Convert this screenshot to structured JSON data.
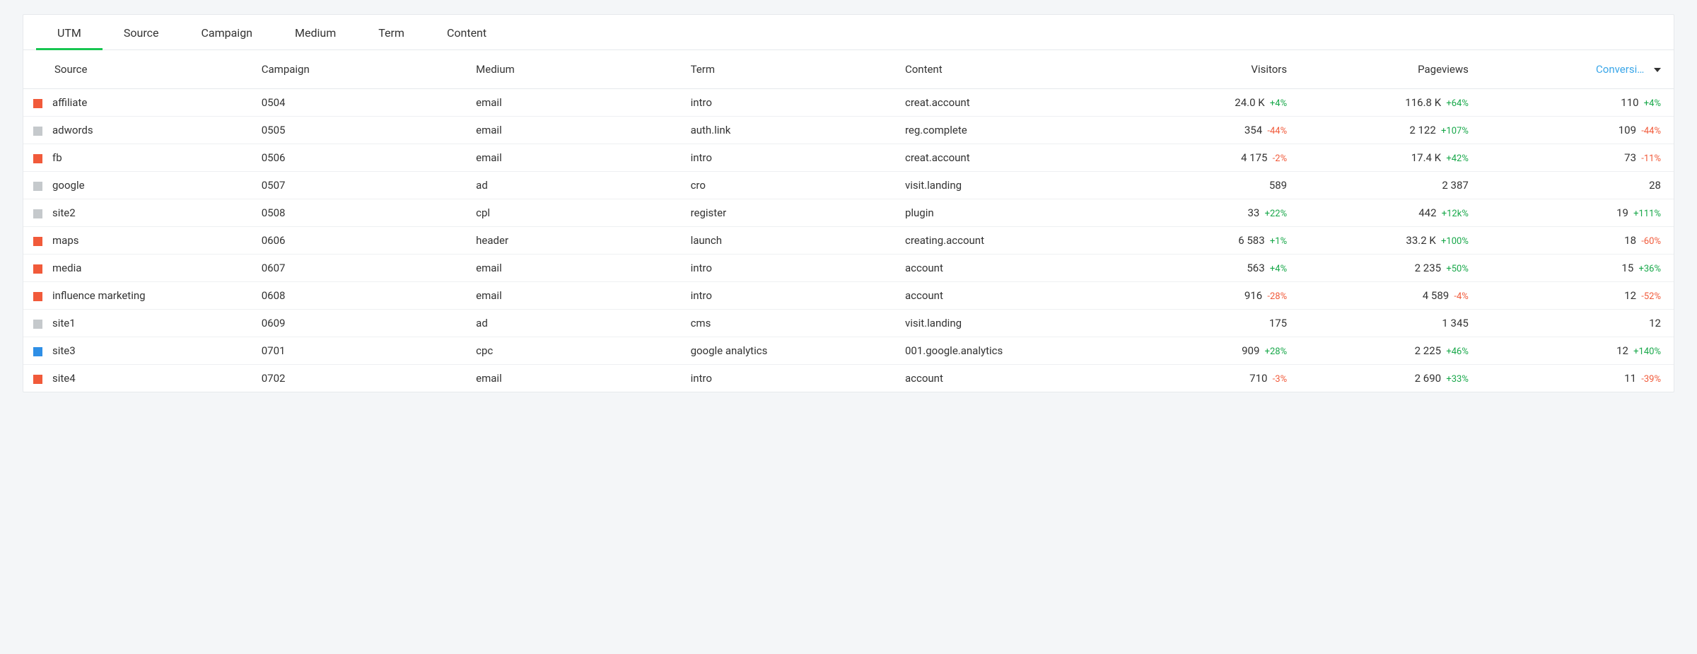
{
  "tabs": [
    {
      "label": "UTM",
      "active": true
    },
    {
      "label": "Source",
      "active": false
    },
    {
      "label": "Campaign",
      "active": false
    },
    {
      "label": "Medium",
      "active": false
    },
    {
      "label": "Term",
      "active": false
    },
    {
      "label": "Content",
      "active": false
    }
  ],
  "columns": {
    "source": "Source",
    "campaign": "Campaign",
    "medium": "Medium",
    "term": "Term",
    "content": "Content",
    "visitors": "Visitors",
    "pageviews": "Pageviews",
    "conversions": "Conversi…"
  },
  "colors": {
    "orange": "#f15a3a",
    "grey": "#c5c9cc",
    "blue": "#2f8fe6"
  },
  "rows": [
    {
      "color": "orange",
      "source": "affiliate",
      "campaign": "0504",
      "medium": "email",
      "term": "intro",
      "content": "creat.account",
      "visitors": {
        "value": "24.0 K",
        "delta": "+4%",
        "dir": "pos"
      },
      "pageviews": {
        "value": "116.8 K",
        "delta": "+64%",
        "dir": "pos"
      },
      "conversions": {
        "value": "110",
        "delta": "+4%",
        "dir": "pos"
      }
    },
    {
      "color": "grey",
      "source": "adwords",
      "campaign": "0505",
      "medium": "email",
      "term": "auth.link",
      "content": "reg.complete",
      "visitors": {
        "value": "354",
        "delta": "-44%",
        "dir": "neg"
      },
      "pageviews": {
        "value": "2 122",
        "delta": "+107%",
        "dir": "pos"
      },
      "conversions": {
        "value": "109",
        "delta": "-44%",
        "dir": "neg"
      }
    },
    {
      "color": "orange",
      "source": "fb",
      "campaign": "0506",
      "medium": "email",
      "term": "intro",
      "content": "creat.account",
      "visitors": {
        "value": "4 175",
        "delta": "-2%",
        "dir": "neg"
      },
      "pageviews": {
        "value": "17.4 K",
        "delta": "+42%",
        "dir": "pos"
      },
      "conversions": {
        "value": "73",
        "delta": "-11%",
        "dir": "neg"
      }
    },
    {
      "color": "grey",
      "source": "google",
      "campaign": "0507",
      "medium": "ad",
      "term": "cro",
      "content": "visit.landing",
      "visitors": {
        "value": "589",
        "delta": "",
        "dir": ""
      },
      "pageviews": {
        "value": "2 387",
        "delta": "",
        "dir": ""
      },
      "conversions": {
        "value": "28",
        "delta": "",
        "dir": ""
      }
    },
    {
      "color": "grey",
      "source": "site2",
      "campaign": "0508",
      "medium": "cpl",
      "term": "register",
      "content": "plugin",
      "visitors": {
        "value": "33",
        "delta": "+22%",
        "dir": "pos"
      },
      "pageviews": {
        "value": "442",
        "delta": "+12k%",
        "dir": "pos"
      },
      "conversions": {
        "value": "19",
        "delta": "+111%",
        "dir": "pos"
      }
    },
    {
      "color": "orange",
      "source": "maps",
      "campaign": "0606",
      "medium": "header",
      "term": "launch",
      "content": "creating.account",
      "visitors": {
        "value": "6 583",
        "delta": "+1%",
        "dir": "pos"
      },
      "pageviews": {
        "value": "33.2 K",
        "delta": "+100%",
        "dir": "pos"
      },
      "conversions": {
        "value": "18",
        "delta": "-60%",
        "dir": "neg"
      }
    },
    {
      "color": "orange",
      "source": "media",
      "campaign": "0607",
      "medium": "email",
      "term": "intro",
      "content": "account",
      "visitors": {
        "value": "563",
        "delta": "+4%",
        "dir": "pos"
      },
      "pageviews": {
        "value": "2 235",
        "delta": "+50%",
        "dir": "pos"
      },
      "conversions": {
        "value": "15",
        "delta": "+36%",
        "dir": "pos"
      }
    },
    {
      "color": "orange",
      "source": "influence marketing",
      "campaign": "0608",
      "medium": "email",
      "term": "intro",
      "content": "account",
      "visitors": {
        "value": "916",
        "delta": "-28%",
        "dir": "neg"
      },
      "pageviews": {
        "value": "4 589",
        "delta": "-4%",
        "dir": "neg"
      },
      "conversions": {
        "value": "12",
        "delta": "-52%",
        "dir": "neg"
      }
    },
    {
      "color": "grey",
      "source": "site1",
      "campaign": "0609",
      "medium": "ad",
      "term": "cms",
      "content": "visit.landing",
      "visitors": {
        "value": "175",
        "delta": "",
        "dir": ""
      },
      "pageviews": {
        "value": "1 345",
        "delta": "",
        "dir": ""
      },
      "conversions": {
        "value": "12",
        "delta": "",
        "dir": ""
      }
    },
    {
      "color": "blue",
      "source": "site3",
      "campaign": "0701",
      "medium": "cpc",
      "term": "google analytics",
      "content": "001.google.analytics",
      "visitors": {
        "value": "909",
        "delta": "+28%",
        "dir": "pos"
      },
      "pageviews": {
        "value": "2 225",
        "delta": "+46%",
        "dir": "pos"
      },
      "conversions": {
        "value": "12",
        "delta": "+140%",
        "dir": "pos"
      }
    },
    {
      "color": "orange",
      "source": "site4",
      "campaign": "0702",
      "medium": "email",
      "term": "intro",
      "content": "account",
      "visitors": {
        "value": "710",
        "delta": "-3%",
        "dir": "neg"
      },
      "pageviews": {
        "value": "2 690",
        "delta": "+33%",
        "dir": "pos"
      },
      "conversions": {
        "value": "11",
        "delta": "-39%",
        "dir": "neg"
      }
    }
  ]
}
